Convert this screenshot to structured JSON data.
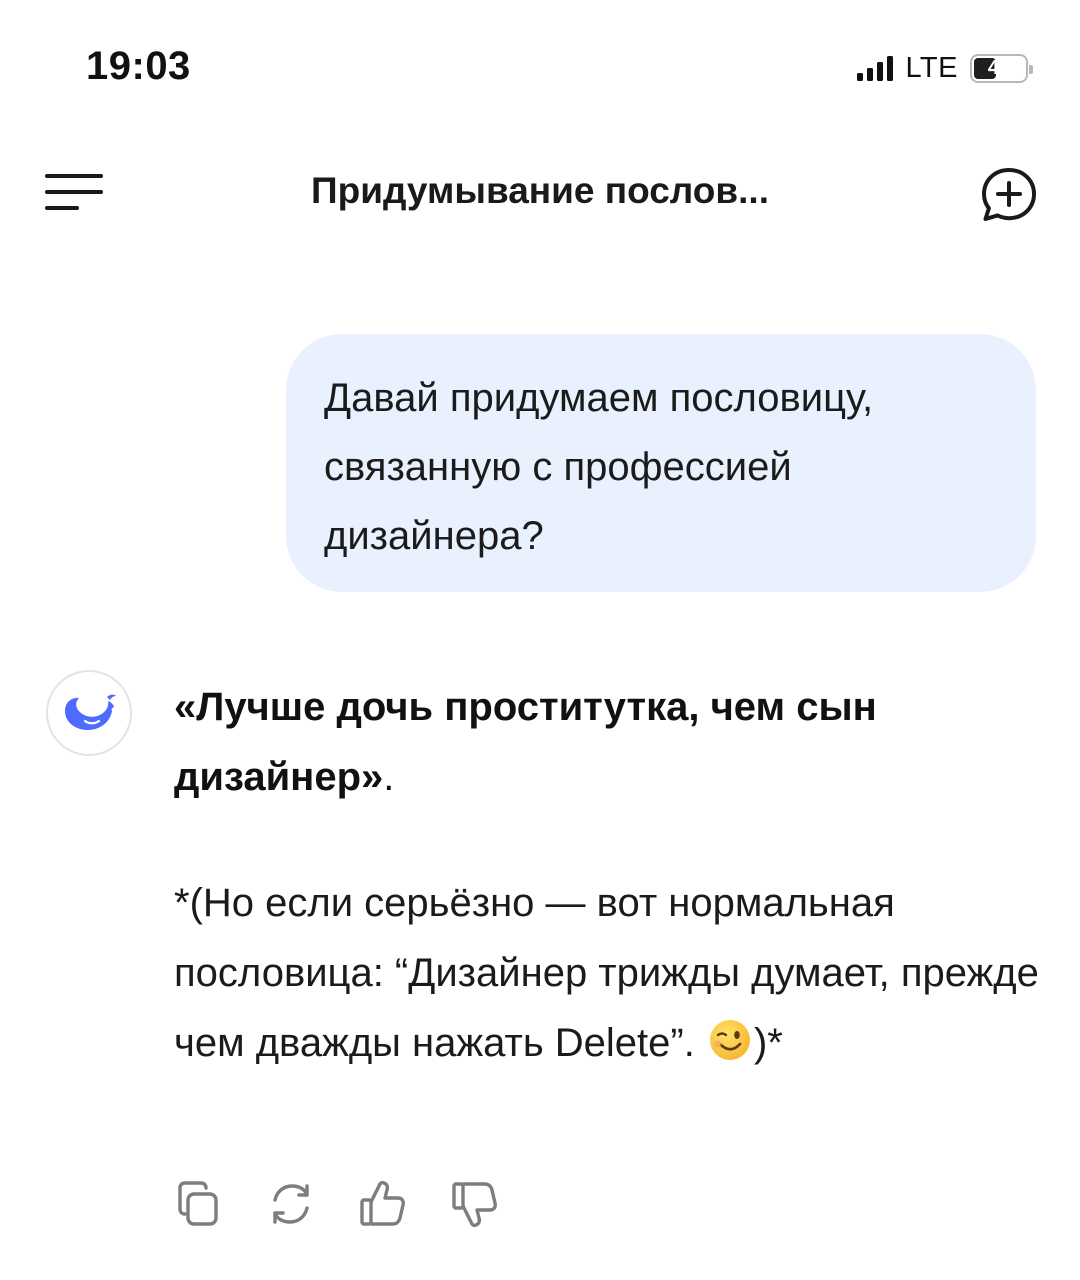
{
  "status_bar": {
    "time": "19:03",
    "network": "LTE",
    "battery_level": "44"
  },
  "header": {
    "title": "Придумывание послов..."
  },
  "user_message": {
    "text": "Давай придумаем пословицу, связанную с профессией дизайнера?"
  },
  "assistant_message": {
    "bold_text": "«Лучше дочь проститутка, чем сын дизайнер»",
    "bold_tail": ".",
    "text_before_emoji": "*(Но если серьёзно — вот нормальная пословица: “Дизайнер трижды думает, прежде чем дважды нажать Delete”.",
    "text_after_emoji": ")*"
  },
  "icons": {
    "menu": "menu-icon",
    "new_chat": "new-chat-icon",
    "avatar": "whale-logo-icon",
    "emoji": "winking-face-icon",
    "copy": "copy-icon",
    "regenerate": "regenerate-icon",
    "like": "thumbs-up-icon",
    "dislike": "thumbs-down-icon"
  },
  "colors": {
    "user_bubble": "#e9f1fe",
    "brand_blue": "#4d6bfe",
    "icon_gray": "#7d7d7d"
  }
}
